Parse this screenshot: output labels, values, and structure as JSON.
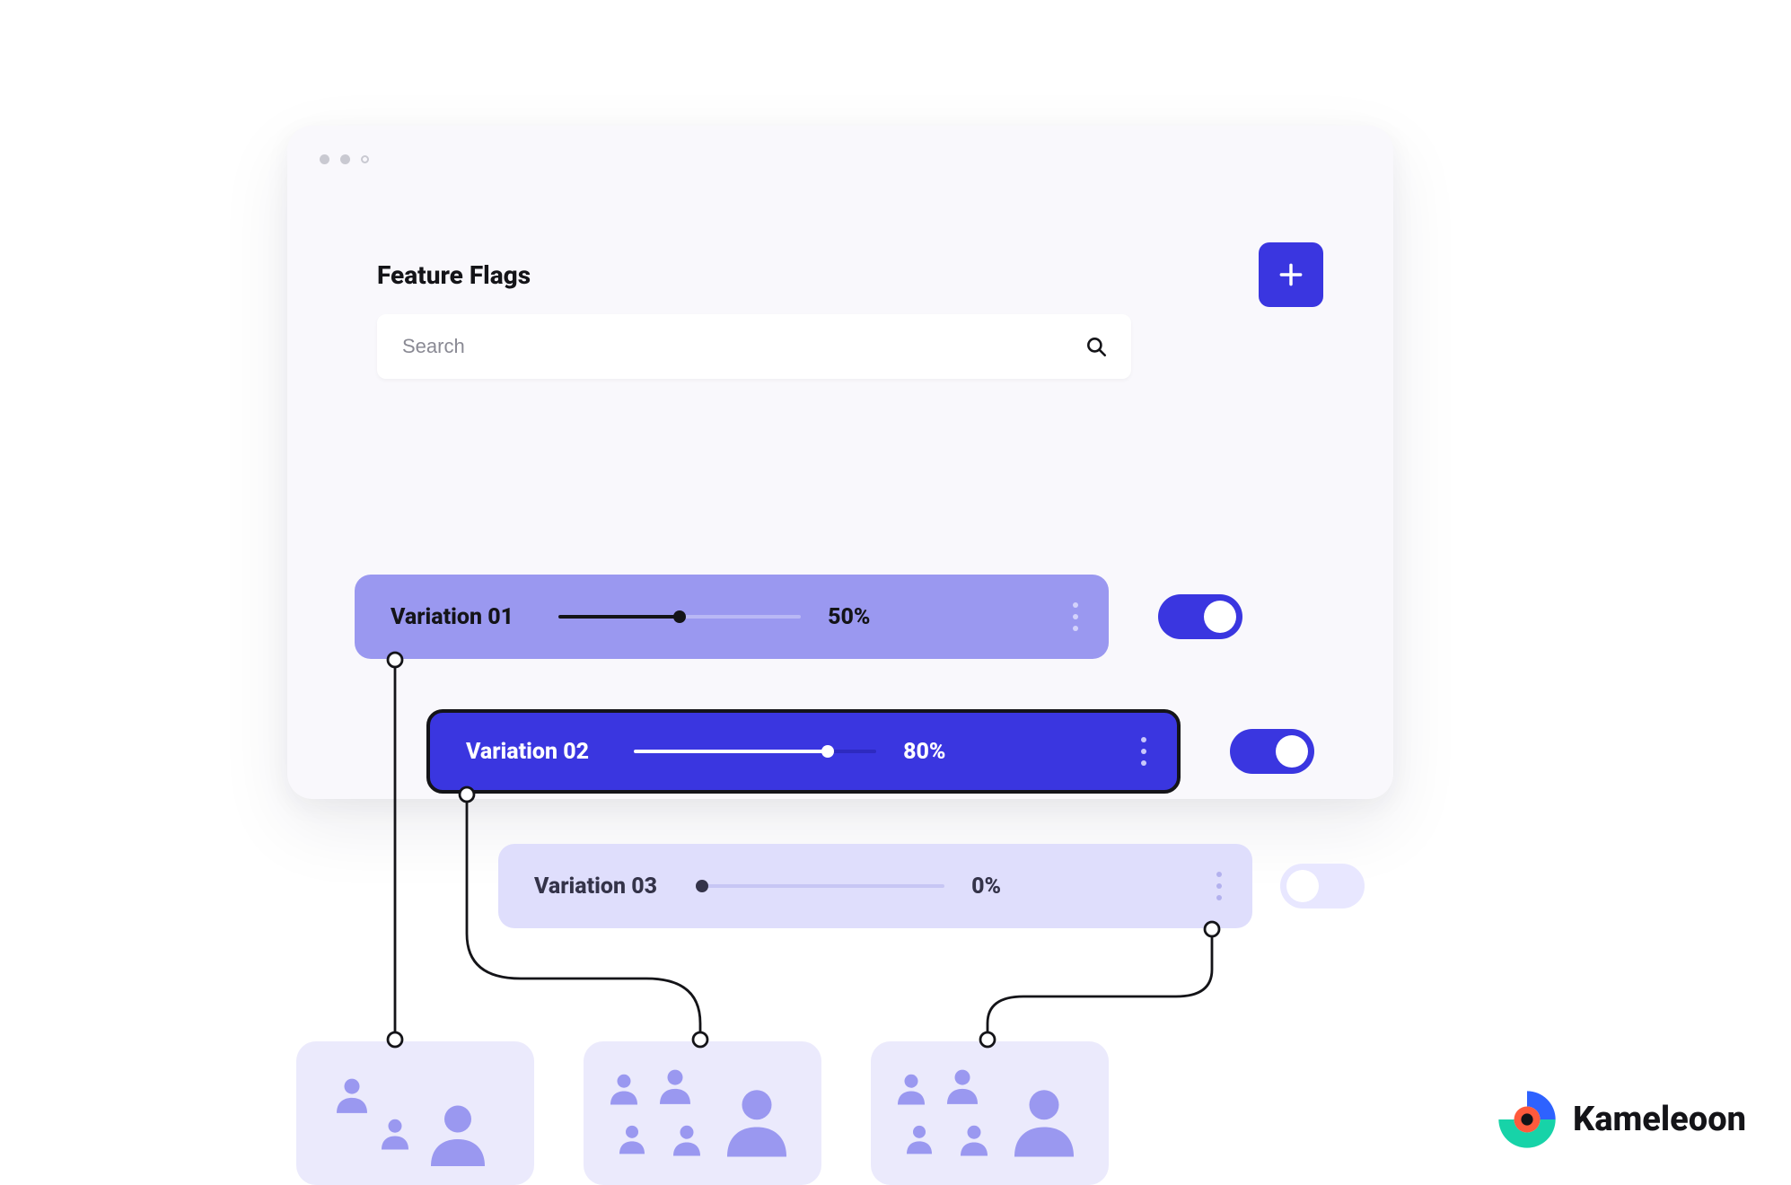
{
  "header": {
    "title": "Feature Flags",
    "add_icon": "plus-icon"
  },
  "search": {
    "placeholder": "Search",
    "value": ""
  },
  "variations": [
    {
      "label": "Variation 01",
      "percent": "50%",
      "value": 50,
      "enabled": true
    },
    {
      "label": "Variation 02",
      "percent": "80%",
      "value": 80,
      "enabled": true
    },
    {
      "label": "Variation 03",
      "percent": "0%",
      "value": 0,
      "enabled": false
    }
  ],
  "brand": {
    "name": "Kameleoon"
  },
  "colors": {
    "primary": "#3a36e0",
    "primary_light": "#9a98f0",
    "primary_pale": "#dfdefc",
    "surface": "#f9f8fc",
    "text": "#141418"
  }
}
